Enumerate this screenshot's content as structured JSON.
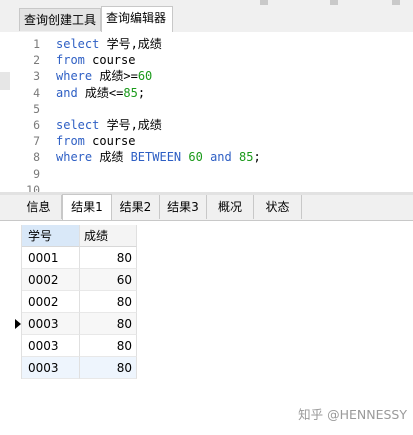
{
  "tabs": [
    {
      "label": "查询创建工具",
      "active": false
    },
    {
      "label": "查询编辑器",
      "active": true
    }
  ],
  "editor": {
    "lines": [
      {
        "n": "1",
        "tokens": [
          {
            "t": "select",
            "k": "kw"
          },
          {
            "t": " 学号,成绩",
            "k": "ident"
          }
        ]
      },
      {
        "n": "2",
        "tokens": [
          {
            "t": "from",
            "k": "kw"
          },
          {
            "t": " course",
            "k": "ident"
          }
        ]
      },
      {
        "n": "3",
        "tokens": [
          {
            "t": "where",
            "k": "kw"
          },
          {
            "t": " 成绩>=",
            "k": "ident"
          },
          {
            "t": "60",
            "k": "num"
          }
        ]
      },
      {
        "n": "4",
        "tokens": [
          {
            "t": "and",
            "k": "kw"
          },
          {
            "t": " 成绩<=",
            "k": "ident"
          },
          {
            "t": "85",
            "k": "num"
          },
          {
            "t": ";",
            "k": "ident"
          }
        ]
      },
      {
        "n": "5",
        "tokens": []
      },
      {
        "n": "6",
        "tokens": [
          {
            "t": "select",
            "k": "kw"
          },
          {
            "t": " 学号,成绩",
            "k": "ident"
          }
        ]
      },
      {
        "n": "7",
        "tokens": [
          {
            "t": "from",
            "k": "kw"
          },
          {
            "t": " course",
            "k": "ident"
          }
        ]
      },
      {
        "n": "8",
        "tokens": [
          {
            "t": "where",
            "k": "kw"
          },
          {
            "t": " 成绩 ",
            "k": "ident"
          },
          {
            "t": "BETWEEN",
            "k": "kw"
          },
          {
            "t": " ",
            "k": "ident"
          },
          {
            "t": "60",
            "k": "num"
          },
          {
            "t": " ",
            "k": "ident"
          },
          {
            "t": "and",
            "k": "kw"
          },
          {
            "t": " ",
            "k": "ident"
          },
          {
            "t": "85",
            "k": "num"
          },
          {
            "t": ";",
            "k": "ident"
          }
        ]
      },
      {
        "n": "9",
        "tokens": []
      },
      {
        "n": "10",
        "tokens": []
      }
    ]
  },
  "result_tabs": [
    {
      "label": "信息",
      "active": false
    },
    {
      "label": "结果1",
      "active": true
    },
    {
      "label": "结果2",
      "active": false
    },
    {
      "label": "结果3",
      "active": false
    },
    {
      "label": "概况",
      "active": false
    },
    {
      "label": "状态",
      "active": false
    }
  ],
  "grid": {
    "columns": [
      "学号",
      "成绩"
    ],
    "rows": [
      [
        "0001",
        "80"
      ],
      [
        "0002",
        "60"
      ],
      [
        "0002",
        "80"
      ],
      [
        "0003",
        "80"
      ],
      [
        "0003",
        "80"
      ],
      [
        "0003",
        "80"
      ]
    ],
    "current_row_index": 3
  },
  "watermark": "知乎 @HENNESSY",
  "colors": {
    "keyword": "#2e5fc4",
    "number": "#1a9a1a",
    "selected_header": "#d9e8f8"
  }
}
